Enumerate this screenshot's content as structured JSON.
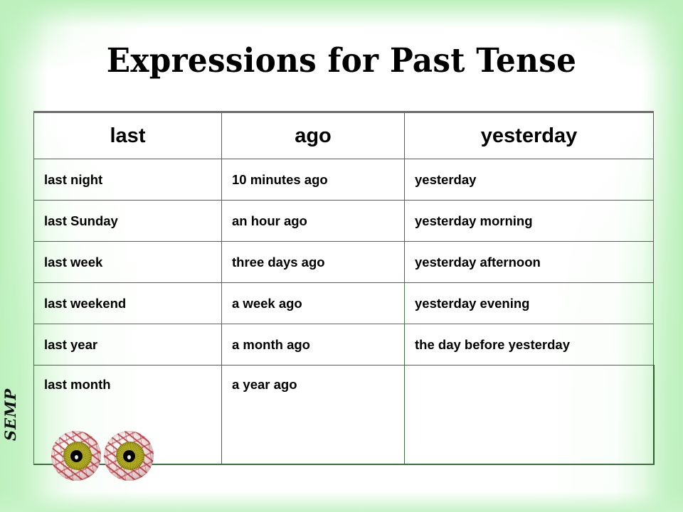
{
  "slide": {
    "title": "Expressions for Past Tense",
    "signature": "SEMP",
    "background_edge_color": "#c6f2c6",
    "background_center_color": "#ffffff",
    "title_color": "#000000"
  },
  "table": {
    "border_color": "#5d5d5d",
    "headers": [
      "last",
      "ago",
      "yesterday"
    ],
    "rows": [
      [
        "last night",
        "10 minutes ago",
        "yesterday"
      ],
      [
        "last Sunday",
        "an hour ago",
        "yesterday morning"
      ],
      [
        "last week",
        "three days ago",
        "yesterday afternoon"
      ],
      [
        "last weekend",
        "a week ago",
        "yesterday evening"
      ],
      [
        "last year",
        "a month ago",
        "the day before yesterday"
      ],
      [
        "last month",
        "a year ago",
        ""
      ]
    ]
  },
  "decorations": {
    "eyes": [
      {
        "name": "eyeball-left",
        "iris_color": "#a79f1f",
        "pupil_color": "#000000"
      },
      {
        "name": "eyeball-right",
        "iris_color": "#a79f1f",
        "pupil_color": "#000000"
      }
    ]
  }
}
